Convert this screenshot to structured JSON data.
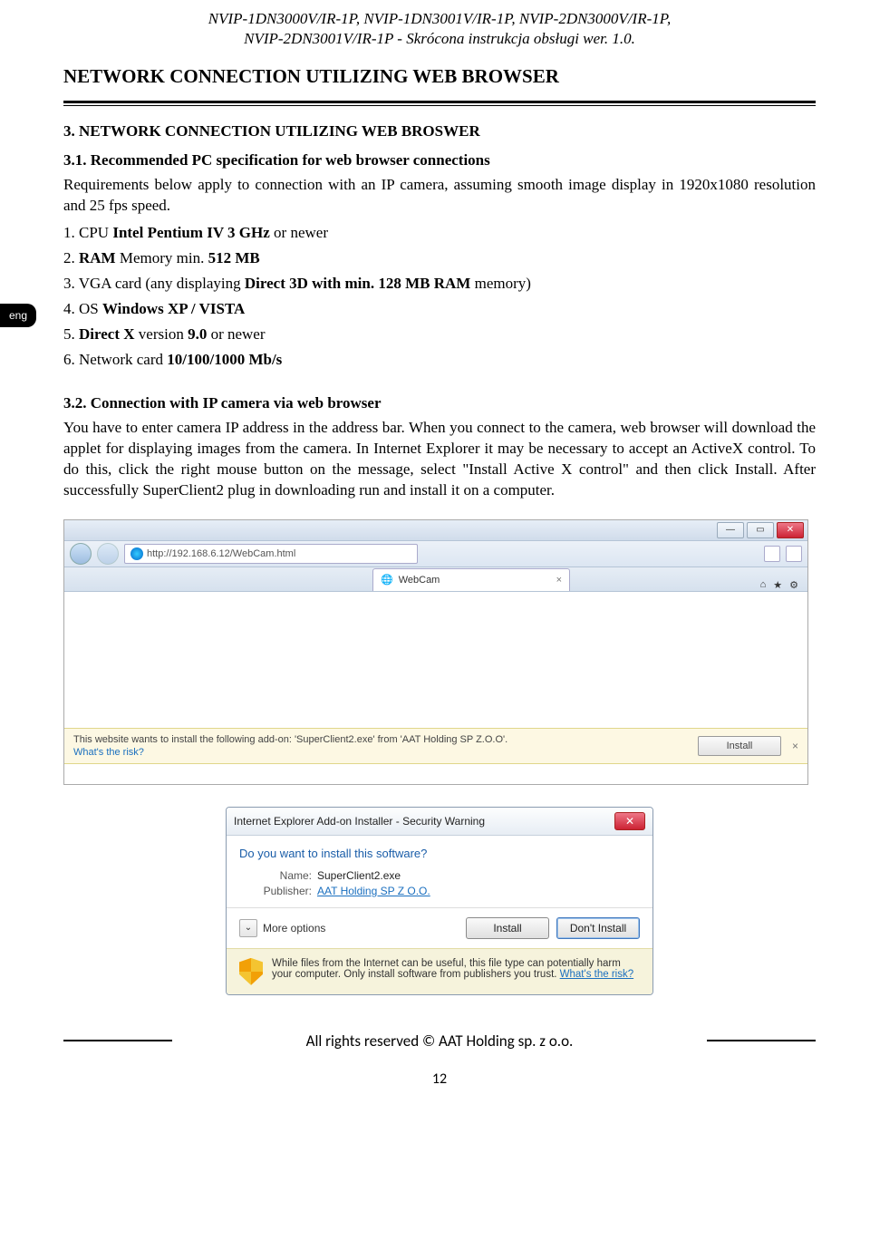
{
  "header": {
    "models": "NVIP-1DN3000V/IR-1P, NVIP-1DN3001V/IR-1P, NVIP-2DN3000V/IR-1P,",
    "subtitle": "NVIP-2DN3001V/IR-1P - Skrócona instrukcja obsługi wer. 1.0."
  },
  "lang_tab": "eng",
  "section_title": "NETWORK CONNECTION UTILIZING WEB BROWSER",
  "s3_title": "3. NETWORK CONNECTION UTILIZING WEB BROSWER",
  "s31_title": "3.1. Recommended PC specification for web browser connections",
  "s31_para": "Requirements below apply to connection with an IP camera, assuming smooth image display in 1920x1080 resolution and 25 fps speed.",
  "reqs": {
    "r1_a": "1. CPU ",
    "r1_b": "Intel Pentium IV 3 GHz",
    "r1_c": " or newer",
    "r2_a": "2. ",
    "r2_b": "RAM",
    "r2_c": " Memory min. ",
    "r2_d": "512 MB",
    "r3_a": "3. VGA card (any displaying ",
    "r3_b": "Direct 3D with min. 128 MB RAM",
    "r3_c": " memory)",
    "r4_a": "4. OS ",
    "r4_b": "Windows XP / VISTA",
    "r5_a": "5. ",
    "r5_b": "Direct X",
    "r5_c": " version ",
    "r5_d": "9.0",
    "r5_e": " or newer",
    "r6_a": "6. Network card ",
    "r6_b": "10/100/1000 Mb/s"
  },
  "s32_title": "3.2. Connection with IP camera via web browser",
  "s32_para": "You have to enter camera IP address in the address bar. When you connect to the camera, web browser will download the applet for displaying images from the camera. In Internet Explorer it may be necessary to accept an ActiveX control. To do this, click the right mouse button on the message, select \"Install Active X control\" and then click Install. After successfully SuperClient2 plug in downloading run and install it on a computer.",
  "browser": {
    "url": "http://192.168.6.12/WebCam.html",
    "tab_label": "WebCam",
    "infobar_text": "This website wants to install the following add-on: 'SuperClient2.exe' from 'AAT Holding SP Z.O.O'.",
    "infobar_link": "What's the risk?",
    "install_btn": "Install"
  },
  "dialog": {
    "title": "Internet Explorer Add-on Installer - Security Warning",
    "question": "Do you want to install this software?",
    "name_label": "Name:",
    "name_value": "SuperClient2.exe",
    "publisher_label": "Publisher:",
    "publisher_value": "AAT Holding SP Z O.O.",
    "more_options": "More options",
    "install": "Install",
    "dont_install": "Don't Install",
    "warning": "While files from the Internet can be useful, this file type can potentially harm your computer. Only install software from publishers you trust. ",
    "warning_link": "What's the risk?"
  },
  "footer": "All rights reserved © AAT Holding sp. z o.o.",
  "page_number": "12"
}
